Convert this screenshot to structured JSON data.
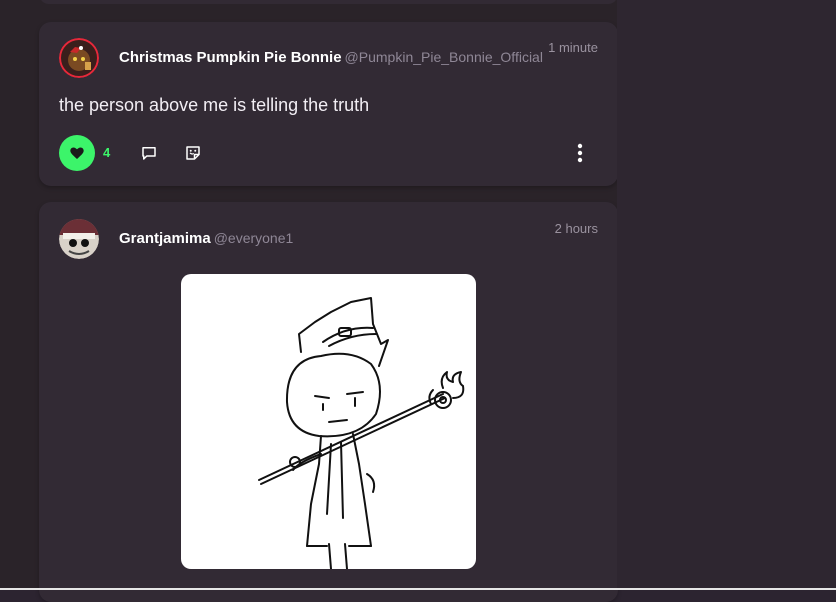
{
  "posts": [
    {
      "author": "Christmas Pumpkin Pie Bonnie",
      "handle": "@Pumpkin_Pie_Bonnie_Official",
      "time": "1 minute",
      "text": "the person above me is telling the truth",
      "likes": "4",
      "liked": true,
      "avatar_icon": "pumpkin-pie-bonnie-avatar-icon"
    },
    {
      "author": "Grantjamima",
      "handle": "@everyone1",
      "time": "2 hours",
      "avatar_icon": "grantjamima-avatar-icon",
      "image_description_icon": "character-drawing"
    }
  ],
  "colors": {
    "background": "#2a2329",
    "card": "#322a34",
    "like_green": "#3cf46a",
    "handle_gray": "#8f8796",
    "avatar_ring": "#e8283a"
  },
  "icons": [
    "heart-icon",
    "comment-icon",
    "sticker-icon",
    "more-vertical-icon"
  ]
}
